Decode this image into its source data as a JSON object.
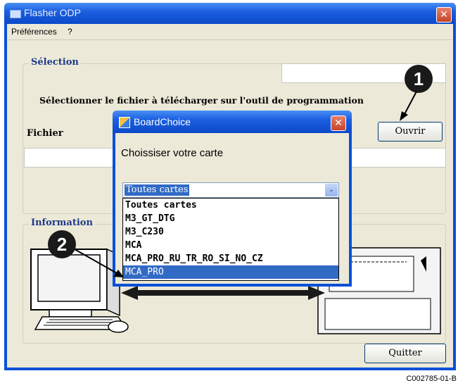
{
  "window": {
    "title": "Flasher ODP",
    "close_glyph": "✕"
  },
  "menu": {
    "items": [
      "Préférences",
      "?"
    ]
  },
  "selection": {
    "group_title": "Sélection",
    "instruction": "Sélectionner le fichier à télécharger sur l'outil de programmation",
    "file_label": "Fichier",
    "file_value": "",
    "status_value": "",
    "open_button": "Ouvrir"
  },
  "information": {
    "group_title": "Information"
  },
  "quit_button": "Quitter",
  "dialog": {
    "title": "BoardChoice",
    "close_glyph": "✕",
    "prompt": "Choissiser votre carte",
    "combo_value": "Toutes cartes",
    "combo_arrow": "⌄",
    "options": [
      "Toutes cartes",
      "M3_GT_DTG",
      "M3_C230",
      "MCA",
      "MCA_PRO_RU_TR_RO_SI_NO_CZ",
      "MCA_PRO"
    ],
    "selected_option": "MCA_PRO"
  },
  "callouts": [
    "1",
    "2"
  ],
  "caption": "C002785-01-B",
  "colors": {
    "title_blue": "#0b49c8",
    "selection_blue": "#316ac5",
    "group_title": "#1f3a8a"
  }
}
